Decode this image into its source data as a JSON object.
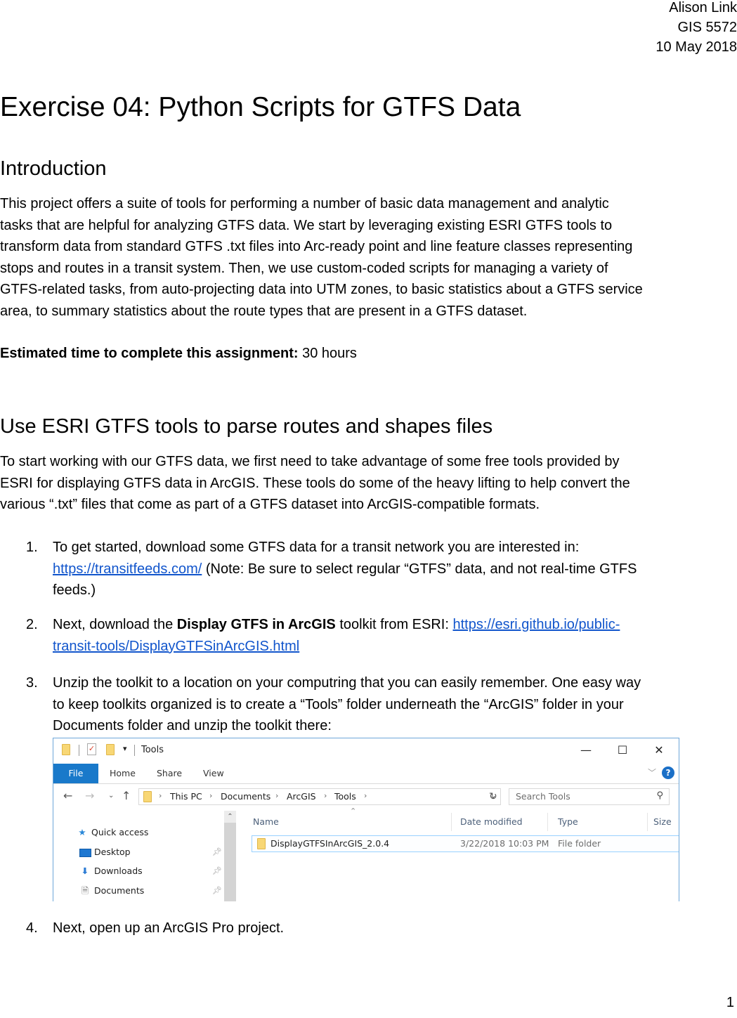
{
  "header": {
    "author": "Alison Link",
    "course": "GIS 5572",
    "date": "10 May 2018"
  },
  "title": "Exercise 04: Python Scripts for GTFS Data",
  "sections": {
    "intro": {
      "heading": "Introduction",
      "lines": [
        "This project offers a suite of tools for performing a number of basic data management and analytic",
        "tasks that are helpful for analyzing GTFS data.  We start by leveraging existing ESRI GTFS tools to",
        "transform data from standard GTFS .txt files into Arc-ready point and line feature classes representing",
        "stops and routes in a transit system.  Then, we use custom-coded scripts for managing a variety of",
        "GTFS-related tasks, from auto-projecting data into UTM zones, to basic statistics about a GTFS service",
        "area, to summary statistics about the route types that are present in a GTFS dataset."
      ],
      "estimate_label": "Estimated time to complete this assignment:",
      "estimate_value": " 30 hours"
    },
    "esri": {
      "heading": "Use ESRI GTFS tools to parse routes and shapes files",
      "lines": [
        "To start working with our GTFS data, we first need to take advantage of some free tools provided by",
        "ESRI for displaying GTFS data in ArcGIS.  These tools do some of the heavy lifting to help convert the",
        "various “.txt” files that come as part of a GTFS dataset into ArcGIS-compatible formats."
      ],
      "steps": [
        {
          "num": "1.",
          "line1": "To get started, download some GTFS data for a transit network you are interested in:",
          "link": "https://transitfeeds.com/",
          "line2_rest": " (Note: Be sure to select regular “GTFS” data, and not real-time GTFS",
          "line3": "feeds.)"
        },
        {
          "num": "2.",
          "pre": "Next, download the ",
          "bold": "Display GTFS in ArcGIS",
          "mid": " toolkit from ESRI: ",
          "link_part1": "https://esri.github.io/public-",
          "link_part2": "transit-tools/DisplayGTFSinArcGIS.html"
        },
        {
          "num": "3.",
          "line1": "Unzip the toolkit to a location on your computring that you can easily remember.  One easy way",
          "line2": "to keep toolkits organized is to create a “Tools” folder underneath the “ArcGIS” folder in your",
          "line3": "Documents folder and unzip the toolkit there:"
        },
        {
          "num": "4.",
          "line1": "Next, open up an ArcGIS Pro project."
        }
      ]
    }
  },
  "explorer": {
    "window_title": "Tools",
    "ribbon_tabs": [
      "File",
      "Home",
      "Share",
      "View"
    ],
    "breadcrumbs": [
      "This PC",
      "Documents",
      "ArcGIS",
      "Tools"
    ],
    "search_placeholder": "Search Tools",
    "nav_pane": [
      {
        "label": "Quick access",
        "icon": "star-icon"
      },
      {
        "label": "Desktop",
        "icon": "desktop-icon",
        "pinned": true
      },
      {
        "label": "Downloads",
        "icon": "download-arrow-icon",
        "pinned": true
      },
      {
        "label": "Documents",
        "icon": "document-icon",
        "pinned": true
      }
    ],
    "columns": [
      "Name",
      "Date modified",
      "Type",
      "Size"
    ],
    "files": [
      {
        "name": "DisplayGTFSInArcGIS_2.0.4",
        "date_modified": "3/22/2018 10:03 PM",
        "type": "File folder",
        "size": ""
      }
    ],
    "accent_color": "#1979ca"
  },
  "page_number": "1"
}
